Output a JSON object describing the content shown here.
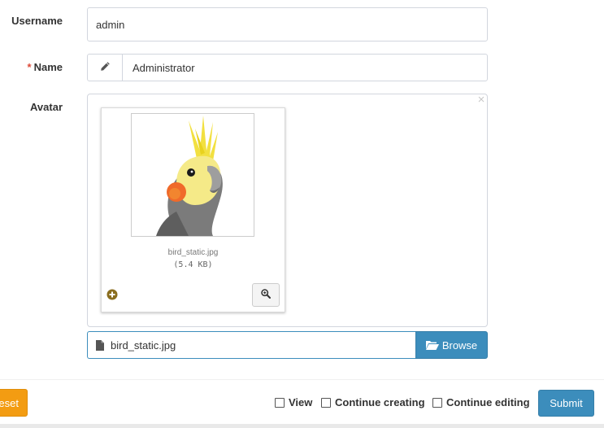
{
  "form": {
    "username": {
      "label": "Username",
      "value": "admin"
    },
    "name": {
      "required_mark": "*",
      "label": "Name",
      "value": "Administrator",
      "addon_icon": "pencil-icon"
    },
    "avatar": {
      "label": "Avatar",
      "close_glyph": "×",
      "preview": {
        "filename": "bird_static.jpg",
        "size": "(5.4 KB)",
        "image_icon": "cockatiel-bird-image",
        "status_icon": "plus-circle-icon",
        "zoom_icon": "zoom-in-icon"
      },
      "caption": {
        "file_icon": "file-icon",
        "filename": "bird_static.jpg"
      },
      "browse": {
        "icon": "folder-open-icon",
        "label": "Browse"
      }
    }
  },
  "footer": {
    "reset_label": "eset",
    "checks": [
      {
        "label": "View",
        "checked": false
      },
      {
        "label": "Continue creating",
        "checked": false
      },
      {
        "label": "Continue editing",
        "checked": false
      }
    ],
    "submit_label": "Submit"
  },
  "colors": {
    "primary": "#3c8dbc",
    "warning": "#f39c12",
    "required": "#dd4b39",
    "border": "#d2d6de"
  }
}
